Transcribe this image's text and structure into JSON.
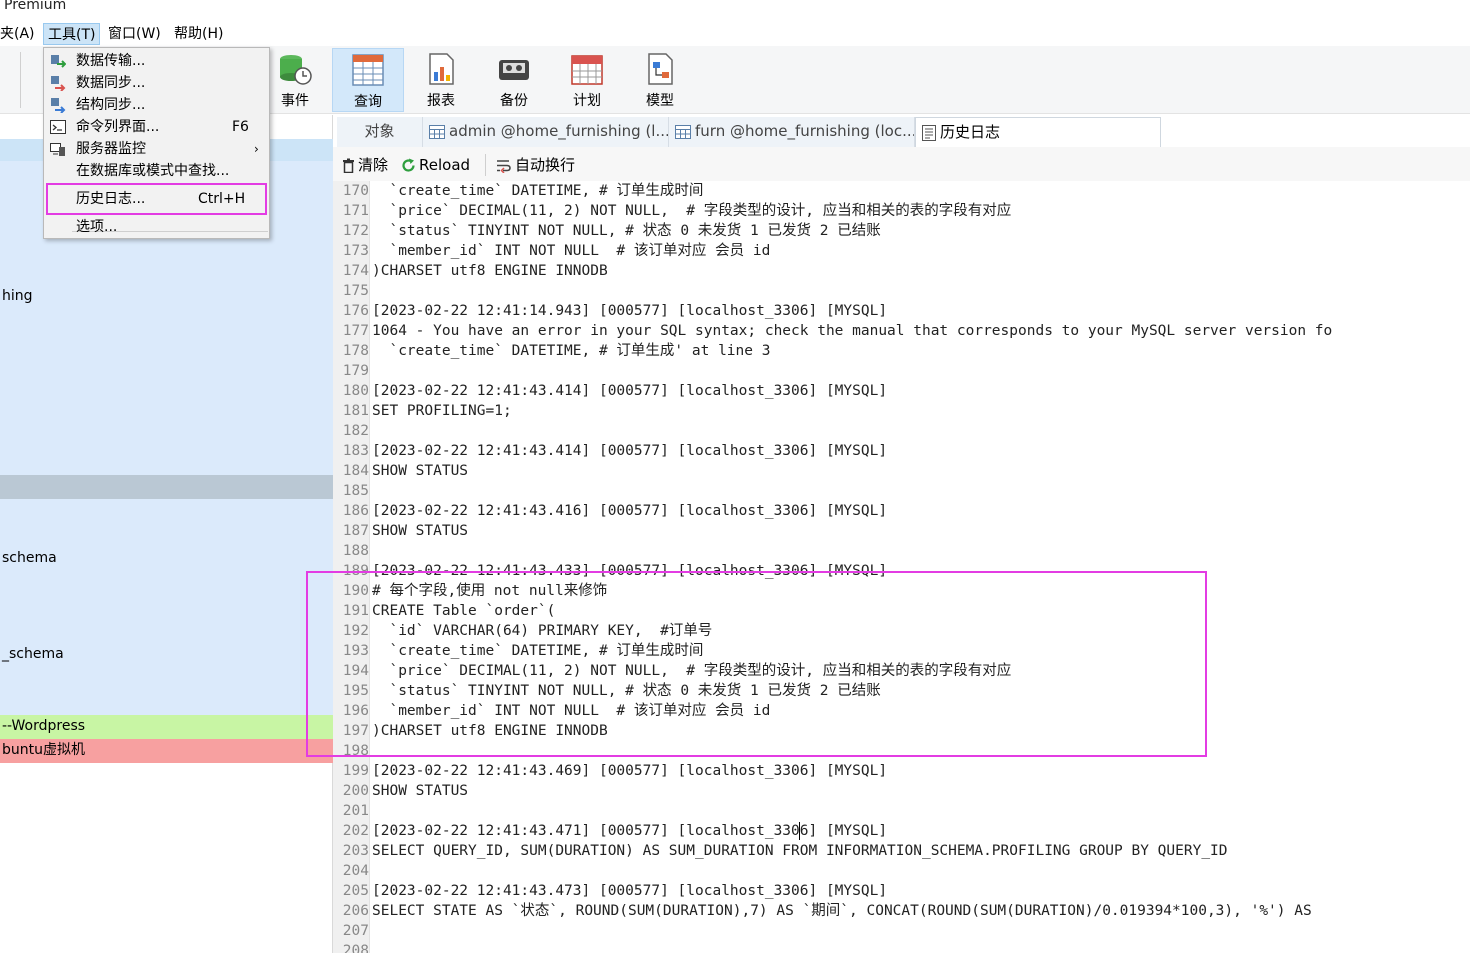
{
  "app": {
    "title_fragment": "Premium"
  },
  "colors": {
    "sidebar_selected": "#cce4f7",
    "sidebar_fill": "#dbeafb",
    "sidebar_gray": "#bac8d4",
    "sidebar_green": "#c8f5a4",
    "sidebar_red": "#f7a0a0",
    "highlight": "#e33ce3"
  },
  "menubar": {
    "items": [
      "夹(A)",
      "工具(T)",
      "窗口(W)",
      "帮助(H)"
    ]
  },
  "toolbar": {
    "buttons": [
      {
        "label": "事件",
        "icon": "event-icon"
      },
      {
        "label": "查询",
        "icon": "query-icon"
      },
      {
        "label": "报表",
        "icon": "report-icon"
      },
      {
        "label": "备份",
        "icon": "backup-icon"
      },
      {
        "label": "计划",
        "icon": "schedule-icon"
      },
      {
        "label": "模型",
        "icon": "model-icon"
      }
    ]
  },
  "tools_menu": {
    "items": [
      {
        "label": "数据传输...",
        "shortcut": "",
        "icon": "data-transfer-icon"
      },
      {
        "label": "数据同步...",
        "shortcut": "",
        "icon": "data-sync-icon"
      },
      {
        "label": "结构同步...",
        "shortcut": "",
        "icon": "structure-sync-icon"
      },
      {
        "label": "命令列界面...",
        "shortcut": "F6",
        "icon": "console-icon"
      },
      {
        "label": "服务器监控",
        "shortcut": "",
        "icon": "server-monitor-icon",
        "arrow": "›"
      },
      {
        "label": "在数据库或模式中查找...",
        "shortcut": "",
        "icon": ""
      },
      {
        "label": "历史日志...",
        "shortcut": "Ctrl+H",
        "icon": ""
      },
      {
        "label": "选项...",
        "shortcut": "",
        "icon": ""
      }
    ]
  },
  "sidebar": {
    "labels": [
      "hing",
      "schema",
      "_schema",
      "--Wordpress",
      "buntu虚拟机"
    ]
  },
  "tabs": [
    {
      "label": "对象"
    },
    {
      "label": "admin @home_furnishing (l..."
    },
    {
      "label": "furn @home_furnishing (loc..."
    },
    {
      "label": "历史日志"
    }
  ],
  "log_toolbar": {
    "clear": "清除",
    "reload": "Reload",
    "wrap": "自动换行"
  },
  "log_lines": [
    {
      "n": "170",
      "t": "  `create_time` DATETIME, # 订单生成时间"
    },
    {
      "n": "171",
      "t": "  `price` DECIMAL(11, 2) NOT NULL,  # 字段类型的设计, 应当和相关的表的字段有对应"
    },
    {
      "n": "172",
      "t": "  `status` TINYINT NOT NULL, # 状态 0 未发货 1 已发货 2 已结账"
    },
    {
      "n": "173",
      "t": "  `member_id` INT NOT NULL  # 该订单对应 会员 id"
    },
    {
      "n": "174",
      "t": ")CHARSET utf8 ENGINE INNODB"
    },
    {
      "n": "175",
      "t": ""
    },
    {
      "n": "176",
      "t": "[2023-02-22 12:41:14.943] [000577] [localhost_3306] [MYSQL]"
    },
    {
      "n": "177",
      "t": "1064 - You have an error in your SQL syntax; check the manual that corresponds to your MySQL server version fo"
    },
    {
      "n": "178",
      "t": "  `create_time` DATETIME, # 订单生成' at line 3"
    },
    {
      "n": "179",
      "t": ""
    },
    {
      "n": "180",
      "t": "[2023-02-22 12:41:43.414] [000577] [localhost_3306] [MYSQL]"
    },
    {
      "n": "181",
      "t": "SET PROFILING=1;"
    },
    {
      "n": "182",
      "t": ""
    },
    {
      "n": "183",
      "t": "[2023-02-22 12:41:43.414] [000577] [localhost_3306] [MYSQL]"
    },
    {
      "n": "184",
      "t": "SHOW STATUS"
    },
    {
      "n": "185",
      "t": ""
    },
    {
      "n": "186",
      "t": "[2023-02-22 12:41:43.416] [000577] [localhost_3306] [MYSQL]"
    },
    {
      "n": "187",
      "t": "SHOW STATUS"
    },
    {
      "n": "188",
      "t": ""
    },
    {
      "n": "189",
      "t": "[2023-02-22 12:41:43.433] [000577] [localhost_3306] [MYSQL]"
    },
    {
      "n": "190",
      "t": "# 每个字段,使用 not null来修饰"
    },
    {
      "n": "191",
      "t": "CREATE Table `order`("
    },
    {
      "n": "192",
      "t": "  `id` VARCHAR(64) PRIMARY KEY,  #订单号"
    },
    {
      "n": "193",
      "t": "  `create_time` DATETIME, # 订单生成时间"
    },
    {
      "n": "194",
      "t": "  `price` DECIMAL(11, 2) NOT NULL,  # 字段类型的设计, 应当和相关的表的字段有对应"
    },
    {
      "n": "195",
      "t": "  `status` TINYINT NOT NULL, # 状态 0 未发货 1 已发货 2 已结账"
    },
    {
      "n": "196",
      "t": "  `member_id` INT NOT NULL  # 该订单对应 会员 id"
    },
    {
      "n": "197",
      "t": ")CHARSET utf8 ENGINE INNODB"
    },
    {
      "n": "198",
      "t": ""
    },
    {
      "n": "199",
      "t": "[2023-02-22 12:41:43.469] [000577] [localhost_3306] [MYSQL]"
    },
    {
      "n": "200",
      "t": "SHOW STATUS"
    },
    {
      "n": "201",
      "t": ""
    },
    {
      "n": "202",
      "t": "[2023-02-22 12:41:43.471] [000577] [localhost_3306] [MYSQL]"
    },
    {
      "n": "203",
      "t": "SELECT QUERY_ID, SUM(DURATION) AS SUM_DURATION FROM INFORMATION_SCHEMA.PROFILING GROUP BY QUERY_ID"
    },
    {
      "n": "204",
      "t": ""
    },
    {
      "n": "205",
      "t": "[2023-02-22 12:41:43.473] [000577] [localhost_3306] [MYSQL]"
    },
    {
      "n": "206",
      "t": "SELECT STATE AS `状态`, ROUND(SUM(DURATION),7) AS `期间`, CONCAT(ROUND(SUM(DURATION)/0.019394*100,3), '%') AS"
    },
    {
      "n": "207",
      "t": ""
    },
    {
      "n": "208",
      "t": ""
    }
  ]
}
